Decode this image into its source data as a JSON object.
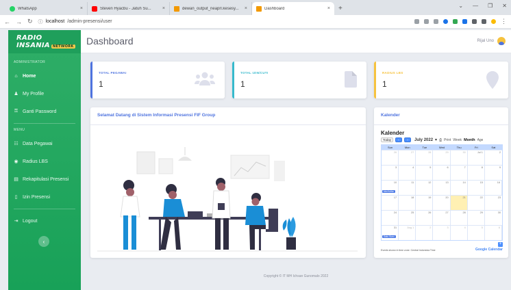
{
  "browser": {
    "tabs": [
      {
        "title": "WhatsApp",
        "color": "#25d366",
        "active": false
      },
      {
        "title": "Steven Hyacbu - Jatuh Su...",
        "color": "#ff0000",
        "active": false
      },
      {
        "title": "dewan_output_neaprl.kesesy...",
        "color": "#f29900",
        "active": false
      },
      {
        "title": "Dashboard",
        "color": "#f29900",
        "active": true
      }
    ],
    "new_tab": "+",
    "url_host": "localhost",
    "url_path": "/admin-presensi/user"
  },
  "sidebar": {
    "brand_main": "RADIO INSANIA",
    "brand_sub": "NETWORK",
    "section_admin": "ADMINISTRATOR",
    "section_menu": "MENU",
    "items_admin": [
      {
        "label": "Home",
        "icon": "home-icon",
        "glyph": "⌂",
        "active": true
      },
      {
        "label": "My Profile",
        "icon": "user-icon",
        "glyph": "♟",
        "active": false
      },
      {
        "label": "Ganti Password",
        "icon": "key-icon",
        "glyph": "⚿",
        "active": false
      }
    ],
    "items_menu": [
      {
        "label": "Data Pegawai",
        "icon": "users-icon",
        "glyph": "☷",
        "active": false
      },
      {
        "label": "Radius LBS",
        "icon": "location-icon",
        "glyph": "◉",
        "active": false
      },
      {
        "label": "Rekapitulasi Presensi",
        "icon": "table-icon",
        "glyph": "▤",
        "active": false
      },
      {
        "label": "Izin Presensi",
        "icon": "file-icon",
        "glyph": "▯",
        "active": false
      }
    ],
    "logout_label": "Logout",
    "toggle_glyph": "‹"
  },
  "header": {
    "title": "Dashboard",
    "user_name": "Rijal Uno"
  },
  "stats": [
    {
      "label": "TOTAL PEGAWAI",
      "value": "1",
      "color": "#4e73df",
      "icon": "users-icon"
    },
    {
      "label": "TOTAL IZIN/CUTI",
      "value": "1",
      "color": "#36b9cc",
      "icon": "file-icon"
    },
    {
      "label": "RADIUS LBS",
      "value": "1",
      "color": "#f6c23e",
      "icon": "map-marker-icon"
    }
  ],
  "welcome": {
    "title": "Selamat Datang di Sistem Informasi Presensi FIF Group"
  },
  "calendar": {
    "card_title": "Kalender",
    "title": "Kalender",
    "today_label": "Today",
    "month_label": "July 2022",
    "print_label": "Print",
    "views": [
      "Week",
      "Month",
      "Agenda"
    ],
    "selected_view": "Month",
    "weekdays": [
      "Sun",
      "Mon",
      "Tue",
      "Wed",
      "Thu",
      "Fri",
      "Sat"
    ],
    "weeks": [
      [
        "26",
        "27",
        "28",
        "29",
        "30",
        "Jul 1",
        "2"
      ],
      [
        "3",
        "4",
        "5",
        "6",
        "7",
        "8",
        "9"
      ],
      [
        "10",
        "11",
        "12",
        "13",
        "14",
        "15",
        "16"
      ],
      [
        "17",
        "18",
        "19",
        "20",
        "21",
        "22",
        "23"
      ],
      [
        "24",
        "25",
        "26",
        "27",
        "28",
        "29",
        "30"
      ],
      [
        "31",
        "Aug 1",
        "2",
        "3",
        "4",
        "5",
        "6"
      ]
    ],
    "today_date": "21",
    "events": [
      {
        "week": 2,
        "label": "Idul Adha"
      },
      {
        "week": 5,
        "label": "Satu Suro"
      }
    ],
    "footer_text": "Events shown in time zone: Central Indonesia Time",
    "brand": "Google Calendar"
  },
  "footer": {
    "copyright": "Copyright © IT MH Ichsan Gunomalo 2022"
  }
}
